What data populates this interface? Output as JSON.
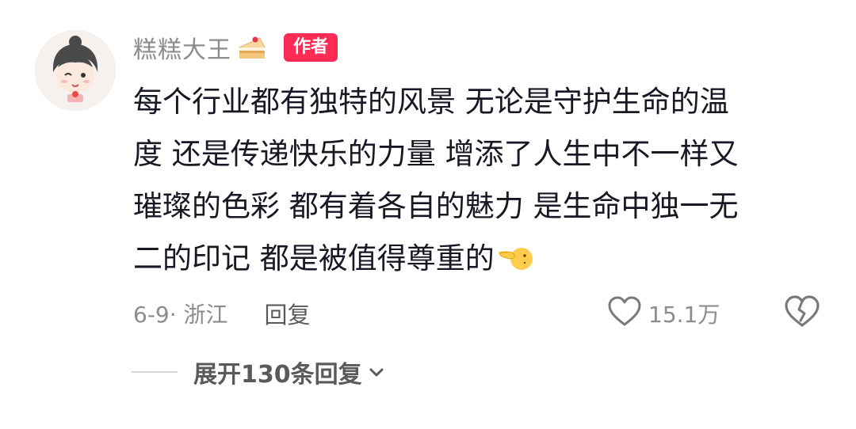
{
  "comment": {
    "username": "糕糕大王",
    "badge": "作者",
    "content_lines": [
      "每个行业都有独特的风景 无论是守护生命的温",
      "度 还是传递快乐的力量 增添了人生中不一样又",
      "璀璨的色彩 都有着各自的魅力 是生命中独一无",
      "二的印记  都是被值得尊重的"
    ],
    "emojis": {
      "after_username": "cake-icon",
      "after_content": "pointing-face-icon"
    },
    "meta": "6-9· 浙江",
    "reply_label": "回复",
    "like_count": "15.1万",
    "expand_label": "展开130条回复",
    "colors": {
      "badge_bg": "#fe2c55",
      "text_main": "#161823",
      "text_muted": "#8c8c8c"
    }
  }
}
